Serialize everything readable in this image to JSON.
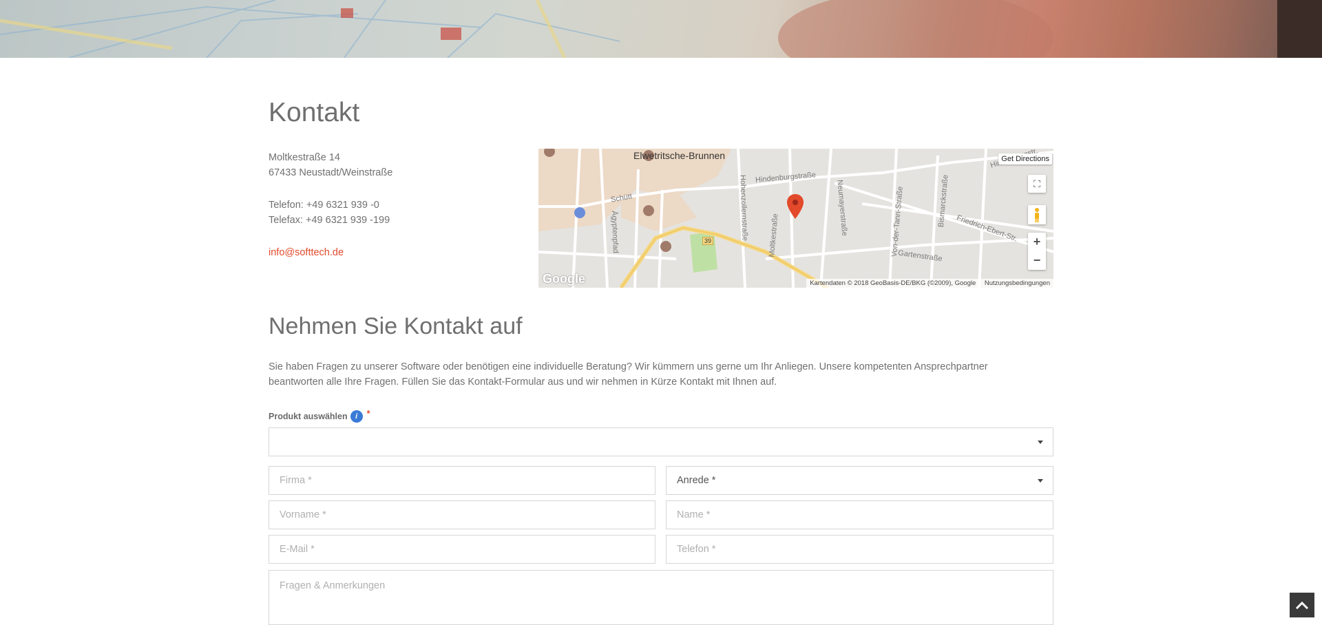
{
  "contact": {
    "title": "Kontakt",
    "street": "Moltkestraße 14",
    "city": "67433 Neustadt/Weinstraße",
    "phone": "Telefon: +49 6321 939 -0",
    "fax": "Telefax: +49 6321 939 -199",
    "email": "info@softtech.de"
  },
  "map": {
    "directions": "Get Directions",
    "poi": "Elwetritsche-Brunnen",
    "streets": [
      "Hindenburgstraße",
      "Hindenburgstr.",
      "Schütt",
      "Hohenzollernstraße",
      "Neumayerstraße",
      "Von-der-Tann-Straße",
      "Bismarckstraße",
      "Friedrich-Ebert-Str.",
      "Gartenstraße",
      "Moltkestraße",
      "Ägyptenpfad"
    ],
    "road_number": "39",
    "attribution": "Kartendaten © 2018 GeoBasis-DE/BKG (©2009), Google",
    "terms": "Nutzungsbedingungen",
    "logo": "Google",
    "icons": [
      "fullscreen-icon",
      "pegman-icon",
      "zoom-in-icon",
      "zoom-out-icon",
      "map-marker-icon"
    ]
  },
  "form": {
    "heading": "Nehmen Sie Kontakt auf",
    "intro_line1": "Sie haben Fragen zu unserer Software oder benötigen eine individuelle Beratung? Wir kümmern uns gerne um Ihr Anliegen. Unsere kompetenten Ansprechpartner",
    "intro_line2": "beantworten alle Ihre Fragen. Füllen Sie das Kontakt-Formular aus und wir nehmen in Kürze Kontakt mit Ihnen auf.",
    "product_label": "Produkt auswählen",
    "required_mark": "*",
    "firma": "Firma *",
    "anrede": "Anrede *",
    "vorname": "Vorname *",
    "name": "Name *",
    "email": "E-Mail *",
    "telefon": "Telefon *",
    "fragen": "Fragen & Anmerkungen"
  },
  "colors": {
    "accent": "#e24a2b",
    "info": "#3b7bd6",
    "scroll_top_bg": "#3a3a3a"
  }
}
